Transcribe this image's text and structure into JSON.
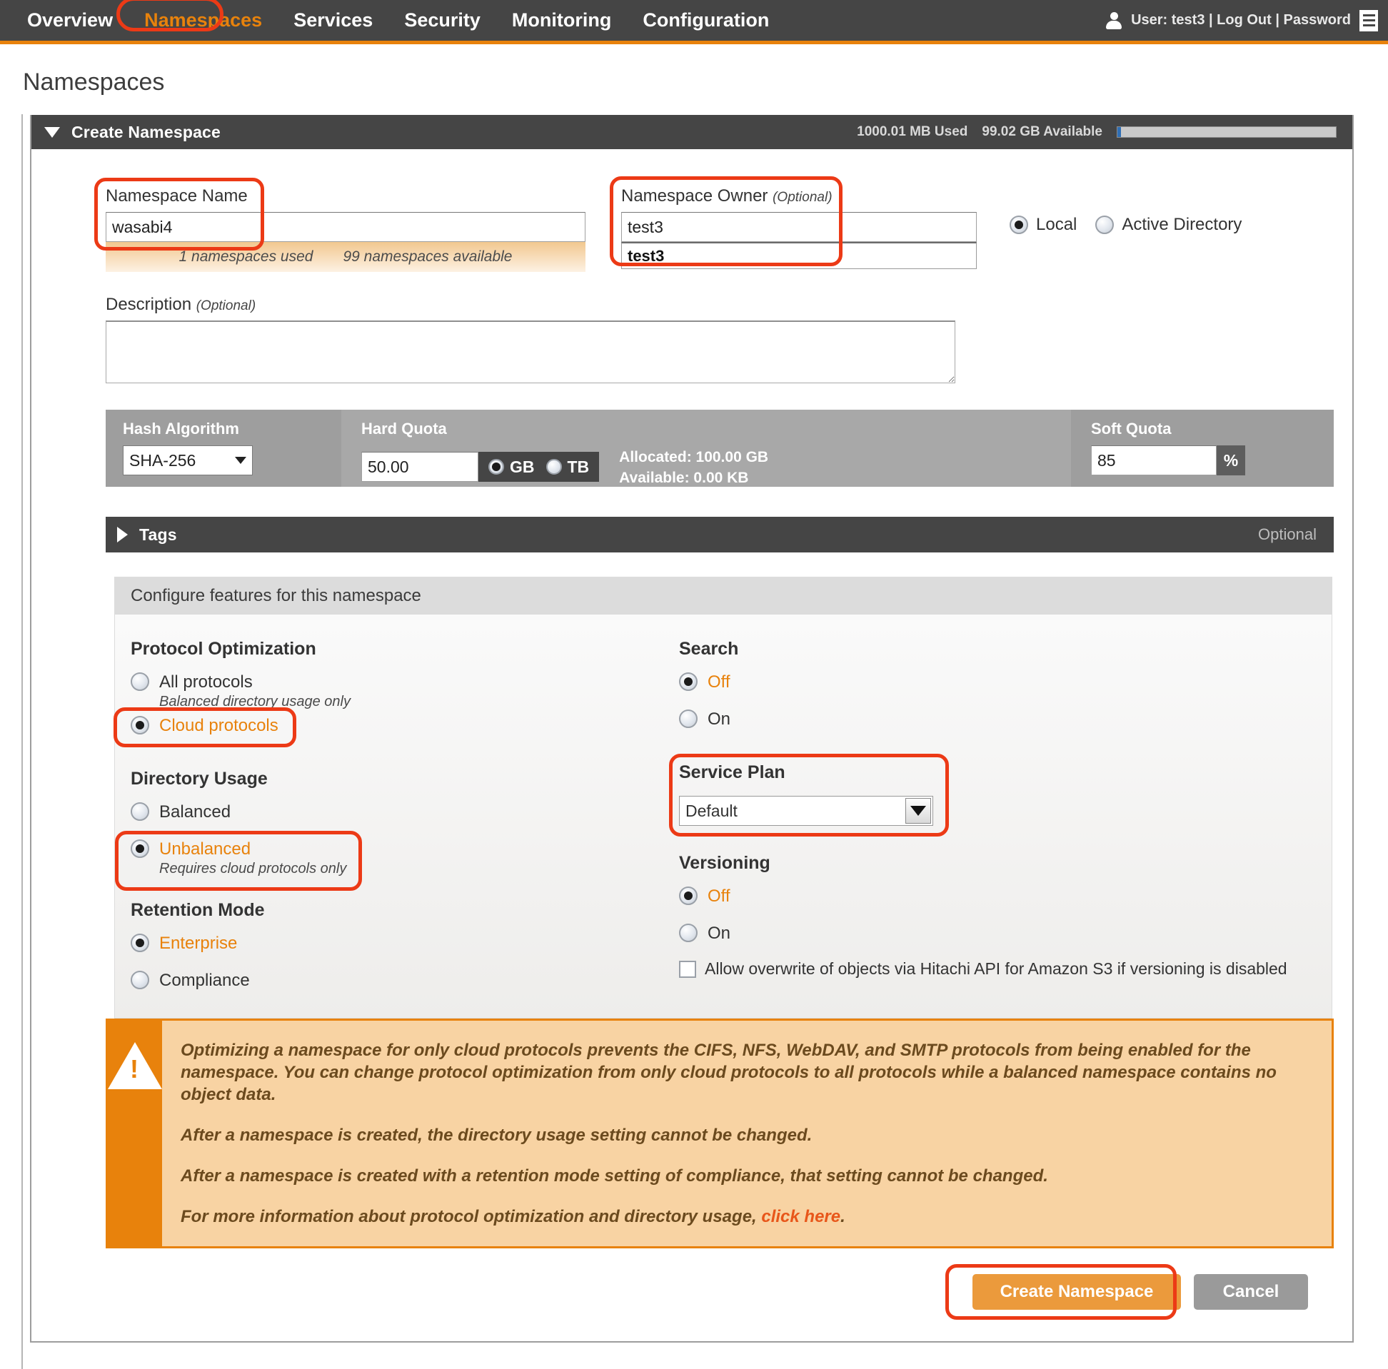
{
  "topnav": {
    "items": [
      {
        "label": "Overview",
        "active": false
      },
      {
        "label": "Namespaces",
        "active": true
      },
      {
        "label": "Services",
        "active": false
      },
      {
        "label": "Security",
        "active": false
      },
      {
        "label": "Monitoring",
        "active": false
      },
      {
        "label": "Configuration",
        "active": false
      }
    ],
    "user_icon": "user-icon",
    "user_text": "User: test3  |  Log Out | Password",
    "menu_icon": "hamburger-menu-icon"
  },
  "page": {
    "title": "Namespaces"
  },
  "panel": {
    "title": "Create Namespace",
    "collapse_icon": "chevron-down-icon",
    "usage_used": "1000.01 MB Used",
    "usage_available": "99.02 GB Available"
  },
  "form": {
    "namespace_name": {
      "label": "Namespace Name",
      "value": "wasabi4",
      "placeholder": ""
    },
    "namespaces_used": "1 namespaces used",
    "namespaces_available": "99 namespaces available",
    "namespace_owner": {
      "label": "Namespace Owner",
      "optional": "(Optional)",
      "value": "test3",
      "suggestion": "test3"
    },
    "owner_type": {
      "local": "Local",
      "active_directory": "Active Directory",
      "selected": "Local"
    },
    "description": {
      "label": "Description",
      "optional": "(Optional)",
      "value": ""
    }
  },
  "quota": {
    "hash_algorithm": {
      "label": "Hash Algorithm",
      "value": "SHA-256"
    },
    "hard_quota": {
      "label": "Hard Quota",
      "value": "50.00",
      "unit_gb": "GB",
      "unit_tb": "TB",
      "selected_unit": "GB"
    },
    "allocated": "Allocated:  100.00 GB",
    "available": "Available:  0.00 KB",
    "soft_quota": {
      "label": "Soft Quota",
      "value": "85",
      "unit": "%"
    }
  },
  "tags": {
    "label": "Tags",
    "optional": "Optional",
    "expand_icon": "chevron-right-icon"
  },
  "features": {
    "header": "Configure features for this namespace",
    "protocol_optimization": {
      "title": "Protocol Optimization",
      "options": [
        {
          "label": "All protocols",
          "sub": "Balanced directory usage only",
          "selected": false
        },
        {
          "label": "Cloud protocols",
          "sub": "",
          "selected": true
        }
      ]
    },
    "directory_usage": {
      "title": "Directory Usage",
      "options": [
        {
          "label": "Balanced",
          "sub": "",
          "selected": false
        },
        {
          "label": "Unbalanced",
          "sub": "Requires cloud protocols only",
          "selected": true
        }
      ]
    },
    "retention_mode": {
      "title": "Retention Mode",
      "options": [
        {
          "label": "Enterprise",
          "sub": "",
          "selected": true
        },
        {
          "label": "Compliance",
          "sub": "",
          "selected": false
        }
      ]
    },
    "search": {
      "title": "Search",
      "options": [
        {
          "label": "Off",
          "selected": true
        },
        {
          "label": "On",
          "selected": false
        }
      ]
    },
    "service_plan": {
      "title": "Service Plan",
      "value": "Default"
    },
    "versioning": {
      "title": "Versioning",
      "options": [
        {
          "label": "Off",
          "selected": true
        },
        {
          "label": "On",
          "selected": false
        }
      ],
      "allow_overwrite": {
        "label": "Allow overwrite of objects via Hitachi API for Amazon S3 if versioning is disabled",
        "checked": false
      }
    }
  },
  "warning": {
    "icon": "warning-triangle-icon",
    "paragraph1": "Optimizing a namespace for only cloud protocols prevents the CIFS, NFS, WebDAV, and SMTP protocols from being enabled for the namespace. You can change protocol optimization from only cloud protocols to all protocols while a balanced namespace contains no object data.",
    "paragraph2": "After a namespace is created, the directory usage setting cannot be changed.",
    "paragraph3": "After a namespace is created with a retention mode setting of compliance, that setting cannot be changed.",
    "paragraph4_prefix": "For more information about protocol optimization and directory usage, ",
    "paragraph4_link": "click here",
    "paragraph4_suffix": "."
  },
  "actions": {
    "create": "Create Namespace",
    "cancel": "Cancel"
  },
  "colors": {
    "accent_orange": "#e8820c",
    "highlight_red": "#ec3a16",
    "nav_dark": "#454545",
    "warn_bg": "#f8d3a3"
  }
}
